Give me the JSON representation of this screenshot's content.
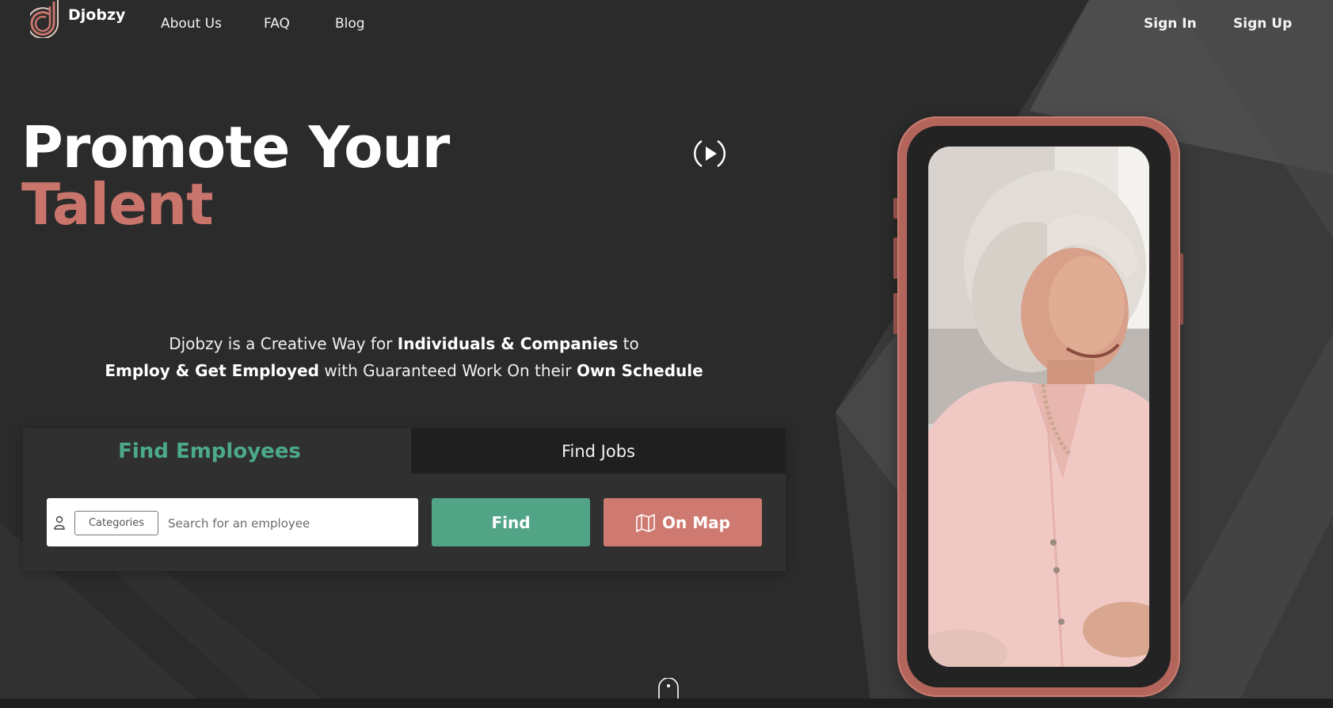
{
  "brand": {
    "name": "Djobzy",
    "logo_icon": "logo-d-icon",
    "accent": "#c9756c",
    "green": "#52a486"
  },
  "nav": {
    "items": [
      "About Us",
      "FAQ",
      "Blog"
    ]
  },
  "auth": {
    "sign_in": "Sign In",
    "sign_up": "Sign Up"
  },
  "hero": {
    "line1": "Promote Your",
    "line2": "Talent",
    "play_icon": "play-circle-icon",
    "tagline": {
      "p1": "Djobzy is a Creative Way for ",
      "b1": "Individuals & Companies",
      "p2": " to",
      "b2": "Employ & Get Employed",
      "p3": " with Guaranteed Work On their ",
      "b3": "Own Schedule"
    }
  },
  "search": {
    "tabs": [
      "Find Employees",
      "Find Jobs"
    ],
    "active_tab": "Find Employees",
    "categories_label": "Categories",
    "placeholder": "Search for an employee",
    "find_label": "Find",
    "map_label": "On Map",
    "icons": [
      "user-icon",
      "map-icon"
    ]
  },
  "scroll_icon": "mouse-scroll-icon",
  "colors": {
    "background": "#2b2b2b",
    "panel": "#303030",
    "tab_inactive": "#1f1f1f",
    "map_button": "#cf7a70",
    "find_button": "#52a486"
  }
}
